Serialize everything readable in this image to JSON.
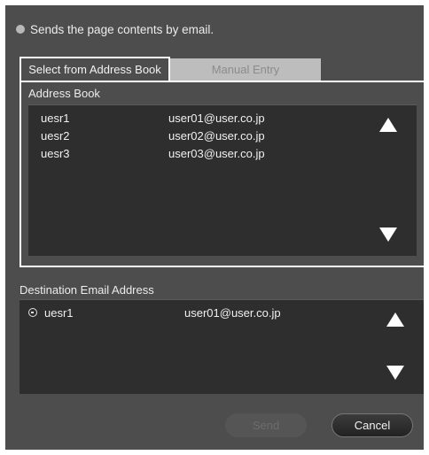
{
  "info_text": "Sends the page contents by email.",
  "tabs": [
    {
      "label": "Select from Address Book",
      "active": true
    },
    {
      "label": "Manual Entry",
      "active": false
    }
  ],
  "address_book": {
    "label": "Address Book",
    "entries": [
      {
        "name": "uesr1",
        "email": "user01@user.co.jp"
      },
      {
        "name": "uesr2",
        "email": "user02@user.co.jp"
      },
      {
        "name": "uesr3",
        "email": "user03@user.co.jp"
      }
    ]
  },
  "destination": {
    "label": "Destination Email Address",
    "entries": [
      {
        "name": "uesr1",
        "email": "user01@user.co.jp"
      }
    ]
  },
  "buttons": {
    "send_label": "Send",
    "cancel_label": "Cancel"
  },
  "icons": {
    "info": "bullet-dot-icon",
    "scroll_up": "triangle-up-icon",
    "scroll_down": "triangle-down-icon",
    "remove": "minus-circle-icon"
  },
  "colors": {
    "dialog_bg": "#4d4d4d",
    "list_bg": "#2e2e2e",
    "inactive_tab_bg": "#bdbdbd"
  }
}
